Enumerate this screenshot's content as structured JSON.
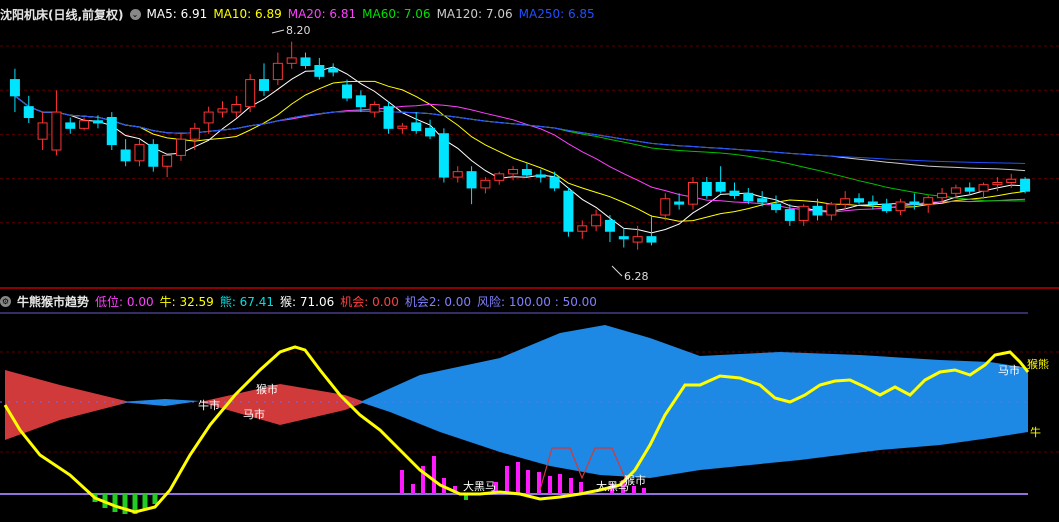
{
  "top_header": {
    "title": "沈阳机床(日线,前复权)",
    "menu_glyph": "⌄",
    "ma": [
      {
        "label": "MA5: 6.91",
        "color": "#ffffff"
      },
      {
        "label": "MA10: 6.89",
        "color": "#ffff00"
      },
      {
        "label": "MA20: 6.81",
        "color": "#ff40ff"
      },
      {
        "label": "MA60: 7.06",
        "color": "#00e000"
      },
      {
        "label": "MA120: 7.06",
        "color": "#cccccc"
      },
      {
        "label": "MA250: 6.85",
        "color": "#2050ff"
      }
    ]
  },
  "price_labels": {
    "high": "8.20",
    "low": "6.28"
  },
  "bottom_header": {
    "title": "牛熊猴市趋势",
    "items": [
      {
        "label": "低位: 0.00",
        "color": "#ff40ff"
      },
      {
        "label": "牛: 32.59",
        "color": "#ffff00"
      },
      {
        "label": "熊: 67.41",
        "color": "#00e0e0"
      },
      {
        "label": "猴: 71.06",
        "color": "#ffffff"
      },
      {
        "label": "机会: 0.00",
        "color": "#ff4040"
      },
      {
        "label": "机会2: 0.00",
        "color": "#8080ff"
      },
      {
        "label": "风险: 100.00 : 50.00",
        "color": "#8080ff"
      }
    ]
  },
  "indicator_labels": {
    "niu_shi": "牛市",
    "ma_shi": "马市",
    "hou_shi": "猴市",
    "da_hei_ma": "大黑马",
    "right_hou_xiong": "猴熊",
    "right_niu": "牛"
  },
  "chart_data": {
    "type": "candlestick",
    "y_range": [
      6.0,
      8.4
    ],
    "candles": [
      [
        7.85,
        7.95,
        7.55,
        7.7
      ],
      [
        7.6,
        7.7,
        7.45,
        7.5
      ],
      [
        7.3,
        7.55,
        7.2,
        7.45
      ],
      [
        7.2,
        7.75,
        7.15,
        7.55
      ],
      [
        7.45,
        7.5,
        7.35,
        7.4
      ],
      [
        7.4,
        7.5,
        7.38,
        7.47
      ],
      [
        7.47,
        7.52,
        7.4,
        7.45
      ],
      [
        7.5,
        7.55,
        7.2,
        7.25
      ],
      [
        7.2,
        7.3,
        7.05,
        7.1
      ],
      [
        7.1,
        7.3,
        7.05,
        7.25
      ],
      [
        7.25,
        7.3,
        7.0,
        7.05
      ],
      [
        7.05,
        7.15,
        6.95,
        7.15
      ],
      [
        7.15,
        7.35,
        7.1,
        7.3
      ],
      [
        7.3,
        7.45,
        7.2,
        7.4
      ],
      [
        7.45,
        7.6,
        7.35,
        7.55
      ],
      [
        7.55,
        7.65,
        7.5,
        7.58
      ],
      [
        7.55,
        7.7,
        7.5,
        7.62
      ],
      [
        7.6,
        7.9,
        7.55,
        7.85
      ],
      [
        7.85,
        8.0,
        7.7,
        7.75
      ],
      [
        7.85,
        8.1,
        7.8,
        8.0
      ],
      [
        8.0,
        8.2,
        7.95,
        8.05
      ],
      [
        8.05,
        8.1,
        7.95,
        7.98
      ],
      [
        7.98,
        8.05,
        7.85,
        7.88
      ],
      [
        7.95,
        8.0,
        7.88,
        7.92
      ],
      [
        7.8,
        7.85,
        7.65,
        7.68
      ],
      [
        7.7,
        7.75,
        7.55,
        7.6
      ],
      [
        7.55,
        7.65,
        7.5,
        7.62
      ],
      [
        7.6,
        7.65,
        7.35,
        7.4
      ],
      [
        7.4,
        7.45,
        7.35,
        7.42
      ],
      [
        7.45,
        7.55,
        7.35,
        7.38
      ],
      [
        7.4,
        7.48,
        7.3,
        7.33
      ],
      [
        7.35,
        7.4,
        6.9,
        6.95
      ],
      [
        6.95,
        7.05,
        6.9,
        7.0
      ],
      [
        7.0,
        7.05,
        6.7,
        6.85
      ],
      [
        6.85,
        6.95,
        6.8,
        6.92
      ],
      [
        6.92,
        7.0,
        6.88,
        6.98
      ],
      [
        6.98,
        7.05,
        6.92,
        7.02
      ],
      [
        7.02,
        7.08,
        6.95,
        6.97
      ],
      [
        6.97,
        7.02,
        6.9,
        6.95
      ],
      [
        6.95,
        7.0,
        6.82,
        6.85
      ],
      [
        6.82,
        6.85,
        6.4,
        6.45
      ],
      [
        6.45,
        6.55,
        6.38,
        6.5
      ],
      [
        6.5,
        6.65,
        6.45,
        6.6
      ],
      [
        6.55,
        6.6,
        6.35,
        6.45
      ],
      [
        6.4,
        6.48,
        6.3,
        6.38
      ],
      [
        6.35,
        6.5,
        6.28,
        6.4
      ],
      [
        6.4,
        6.6,
        6.32,
        6.35
      ],
      [
        6.6,
        6.8,
        6.55,
        6.75
      ],
      [
        6.72,
        6.8,
        6.65,
        6.7
      ],
      [
        6.7,
        6.95,
        6.65,
        6.9
      ],
      [
        6.9,
        6.95,
        6.75,
        6.78
      ],
      [
        6.9,
        7.05,
        6.8,
        6.82
      ],
      [
        6.82,
        6.9,
        6.75,
        6.78
      ],
      [
        6.8,
        6.85,
        6.7,
        6.73
      ],
      [
        6.75,
        6.82,
        6.68,
        6.72
      ],
      [
        6.7,
        6.78,
        6.62,
        6.65
      ],
      [
        6.65,
        6.7,
        6.5,
        6.55
      ],
      [
        6.55,
        6.7,
        6.5,
        6.68
      ],
      [
        6.68,
        6.75,
        6.55,
        6.6
      ],
      [
        6.6,
        6.72,
        6.55,
        6.7
      ],
      [
        6.7,
        6.82,
        6.65,
        6.75
      ],
      [
        6.75,
        6.8,
        6.7,
        6.72
      ],
      [
        6.72,
        6.78,
        6.65,
        6.7
      ],
      [
        6.7,
        6.75,
        6.62,
        6.64
      ],
      [
        6.64,
        6.75,
        6.6,
        6.72
      ],
      [
        6.72,
        6.8,
        6.65,
        6.7
      ],
      [
        6.7,
        6.78,
        6.62,
        6.76
      ],
      [
        6.76,
        6.85,
        6.72,
        6.8
      ],
      [
        6.8,
        6.88,
        6.75,
        6.85
      ],
      [
        6.85,
        6.9,
        6.78,
        6.82
      ],
      [
        6.82,
        6.9,
        6.75,
        6.88
      ],
      [
        6.88,
        6.95,
        6.82,
        6.9
      ],
      [
        6.9,
        6.98,
        6.85,
        6.93
      ],
      [
        6.93,
        6.95,
        6.8,
        6.82
      ]
    ]
  }
}
